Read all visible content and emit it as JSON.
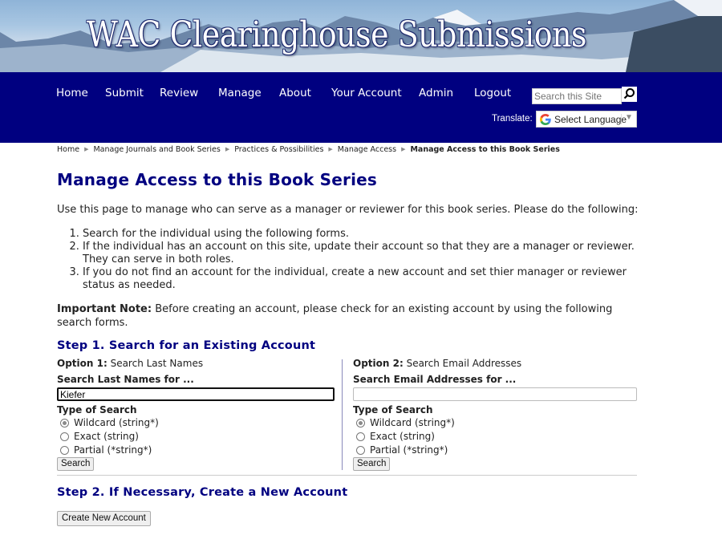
{
  "banner": {
    "title": "WAC Clearinghouse Submissions"
  },
  "nav": {
    "items": [
      {
        "label": "Home"
      },
      {
        "label": "Submit"
      },
      {
        "label": "Review"
      },
      {
        "label": "Manage"
      },
      {
        "label": "About"
      },
      {
        "label": "Your Account"
      },
      {
        "label": "Admin"
      },
      {
        "label": "Logout"
      }
    ],
    "search_placeholder": "Search this Site",
    "search_icon": "magnifier-icon",
    "translate_label": "Translate:",
    "language_select": "Select Language"
  },
  "breadcrumb": {
    "items": [
      {
        "label": "Home"
      },
      {
        "label": "Manage Journals and Book Series"
      },
      {
        "label": "Practices & Possibilities"
      },
      {
        "label": "Manage Access"
      }
    ],
    "current": "Manage Access to this Book Series"
  },
  "page": {
    "title": "Manage Access to this Book Series",
    "intro": "Use this page to manage who can serve as a manager or reviewer for this book series. Please do the following:",
    "steps": [
      "Search for the individual using the following forms.",
      "If the individual has an account on this site, update their account so that they are a manager or reviewer. They can serve in both roles.",
      "If you do not find an account for the individual, create a new account and set thier manager or reviewer status as needed."
    ],
    "note_label": "Important Note:",
    "note_text": " Before creating an account, please check for an existing account by using the following search forms."
  },
  "step1": {
    "heading": "Step 1. Search for an Existing Account",
    "option1": {
      "label": "Option 1:",
      "title": " Search Last Names",
      "field_label": "Search Last Names for ...",
      "value": "Kiefer",
      "type_label": "Type of Search",
      "radios": [
        {
          "label": "Wildcard (string*)",
          "checked": true
        },
        {
          "label": "Exact (string)",
          "checked": false
        },
        {
          "label": "Partial (*string*)",
          "checked": false
        }
      ],
      "button": "Search"
    },
    "option2": {
      "label": "Option 2:",
      "title": " Search Email Addresses",
      "field_label": "Search Email Addresses for ...",
      "value": "",
      "type_label": "Type of Search",
      "radios": [
        {
          "label": "Wildcard (string*)",
          "checked": true
        },
        {
          "label": "Exact (string)",
          "checked": false
        },
        {
          "label": "Partial (*string*)",
          "checked": false
        }
      ],
      "button": "Search"
    }
  },
  "step2": {
    "heading": "Step 2. If Necessary, Create a New Account",
    "button": "Create New Account"
  },
  "colors": {
    "nav_bg": "#000080",
    "heading": "#000080"
  }
}
